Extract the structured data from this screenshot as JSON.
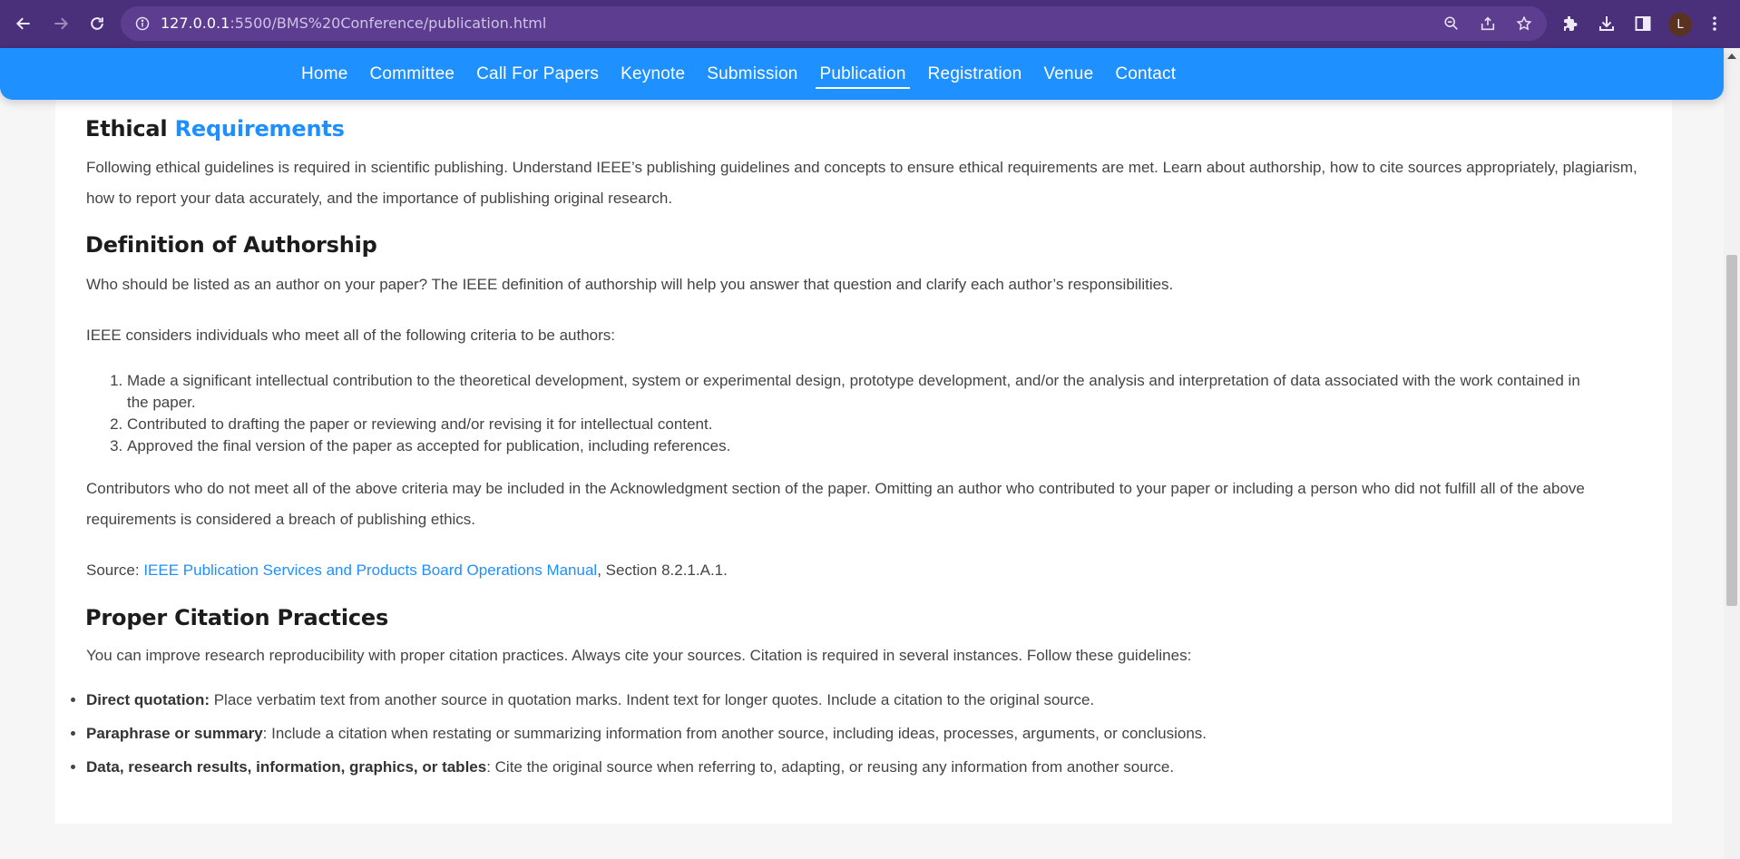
{
  "browser": {
    "url_host": "127.0.0.1",
    "url_rest": ":5500/BMS%20Conference/publication.html",
    "avatar_letter": "L"
  },
  "nav": {
    "items": [
      "Home",
      "Committee",
      "Call For Papers",
      "Keynote",
      "Submission",
      "Publication",
      "Registration",
      "Venue",
      "Contact"
    ],
    "active": "Publication"
  },
  "ethical": {
    "title_a": "Ethical",
    "title_b": "Requirements",
    "body": "Following ethical guidelines is required in scientific publishing. Understand IEEE’s publishing guidelines and concepts to ensure ethical requirements are met. Learn about authorship, how to cite sources appropriately, plagiarism, how to report your data accurately, and the importance of publishing original research."
  },
  "authorship": {
    "title": "Definition of Authorship",
    "intro": "Who should be listed as an author on your paper? The IEEE definition of authorship will help you answer that question and clarify each author’s responsibilities.",
    "criteria_intro": "IEEE considers individuals who meet all of the following criteria to be authors:",
    "criteria": [
      "Made a significant intellectual contribution to the theoretical development, system or experimental design, prototype development, and/or the analysis and interpretation of data associated with the work contained in the paper.",
      "Contributed to drafting the paper or reviewing and/or revising it for intellectual content.",
      "Approved the final version of the paper as accepted for publication, including references."
    ],
    "contributors": "Contributors who do not meet all of the above criteria may be included in the Acknowledgment section of the paper. Omitting an author who contributed to your paper or including a person who did not fulfill all of the above requirements is considered a breach of publishing ethics.",
    "source_label": "Source: ",
    "source_link": "IEEE Publication Services and Products Board Operations Manual",
    "source_suffix": ", Section 8.2.1.A.1."
  },
  "citation": {
    "title": "Proper Citation Practices",
    "intro": "You can improve research reproducibility with proper citation practices. Always cite your sources. Citation is required in several instances. Follow these guidelines:",
    "guidelines": [
      {
        "term": "Direct quotation:",
        "text": " Place verbatim text from another source in quotation marks. Indent text for longer quotes. Include a citation to the original source."
      },
      {
        "term": "Paraphrase or summary",
        "text": ": Include a citation when restating or summarizing information from another source, including ideas, processes, arguments, or conclusions."
      },
      {
        "term": "Data, research results, information, graphics, or tables",
        "text": ": Cite the original source when referring to, adapting, or reusing any information from another source."
      }
    ]
  }
}
